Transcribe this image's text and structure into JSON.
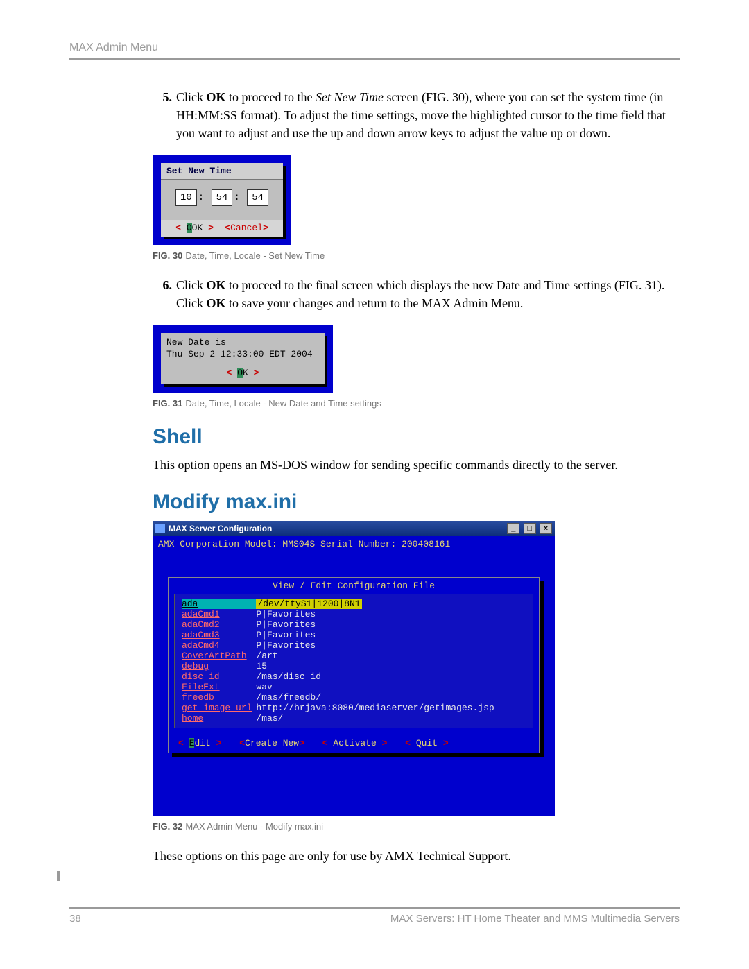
{
  "header": {
    "title": "MAX Admin Menu"
  },
  "steps": {
    "s5": {
      "num": "5.",
      "pre": "Click ",
      "bold1": "OK",
      "mid1": " to proceed to the ",
      "ital": "Set New Time",
      "mid2": " screen (FIG. 30), where you can set the system time (in HH:MM:SS format). To adjust the time settings, move the highlighted cursor to the time field that you want to adjust and use the up and down arrow keys to adjust the value up or down."
    },
    "s6": {
      "num": "6.",
      "pre": "Click ",
      "bold1": "OK",
      "mid1": " to proceed to the final screen which displays the new Date and Time settings (FIG. 31). Click ",
      "bold2": "OK",
      "mid2": " to save your changes and return to the MAX Admin Menu."
    }
  },
  "fig30": {
    "title": "Set New Time",
    "hh": "10",
    "mm": "54",
    "ss": "54",
    "ok": "OK",
    "cancel": "Cancel",
    "caption_label": "FIG. 30",
    "caption": "Date, Time, Locale - Set New Time"
  },
  "fig31": {
    "line1": "New Date is",
    "line2": "Thu Sep  2 12:33:00 EDT 2004",
    "ok": "OK",
    "caption_label": "FIG. 31",
    "caption": "Date, Time, Locale - New Date and Time settings"
  },
  "sections": {
    "shell_title": "Shell",
    "shell_para": "This option opens an MS-DOS window for sending specific commands directly to the server.",
    "modify_title": "Modify max.ini",
    "closing_para": "These options on this page are only for use by AMX Technical Support."
  },
  "fig32": {
    "win_title": "MAX Server Configuration",
    "status": "AMX Corporation   Model: MMS04S    Serial Number: 200408161",
    "panel_title": "View / Edit Configuration File",
    "rows": [
      {
        "k": "ada",
        "v": "/dev/ttyS1|1200|8N1",
        "sel": true
      },
      {
        "k": "adaCmd1",
        "v": "P|Favorites"
      },
      {
        "k": "adaCmd2",
        "v": "P|Favorites"
      },
      {
        "k": "adaCmd3",
        "v": "P|Favorites"
      },
      {
        "k": "adaCmd4",
        "v": "P|Favorites"
      },
      {
        "k": "CoverArtPath",
        "v": "/art"
      },
      {
        "k": "debug",
        "v": "15"
      },
      {
        "k": "disc_id",
        "v": "/mas/disc_id"
      },
      {
        "k": "FileExt",
        "v": "wav"
      },
      {
        "k": "freedb",
        "v": "/mas/freedb/"
      },
      {
        "k": "get_image_url",
        "v": "http://brjava:8080/mediaserver/getimages.jsp"
      },
      {
        "k": "home",
        "v": "/mas/"
      }
    ],
    "btns": {
      "edit": "Edit",
      "create": "Create New",
      "activate": "Activate",
      "quit": "Quit"
    },
    "caption_label": "FIG. 32",
    "caption": "MAX Admin Menu - Modify max.ini"
  },
  "footer": {
    "page": "38",
    "text": "MAX Servers: HT Home Theater and MMS Multimedia Servers"
  }
}
